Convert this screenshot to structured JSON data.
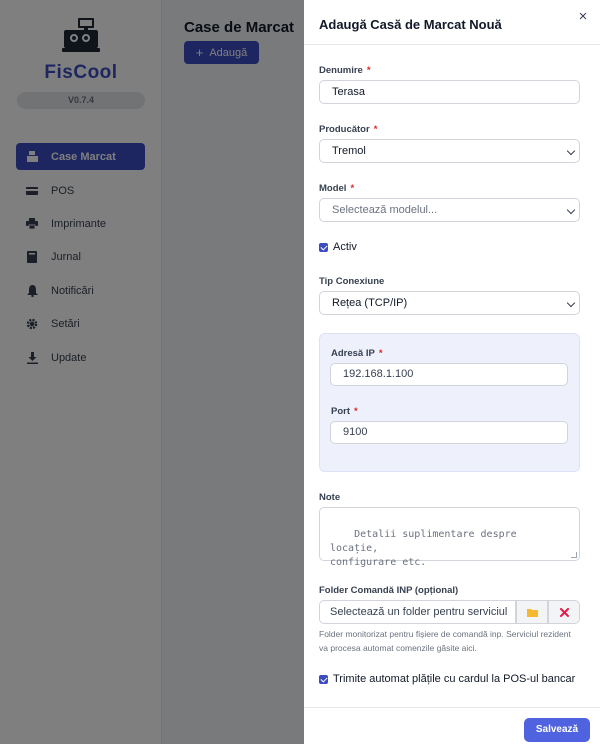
{
  "app": {
    "name": "FisCool",
    "version": "V0.7.4"
  },
  "sidebar": {
    "items": [
      {
        "label": "Case Marcat",
        "icon": "cash-register-icon",
        "active": true
      },
      {
        "label": "POS",
        "icon": "card-terminal-icon"
      },
      {
        "label": "Imprimante",
        "icon": "printer-icon"
      },
      {
        "label": "Jurnal",
        "icon": "book-icon"
      },
      {
        "label": "Notificări",
        "icon": "bell-icon"
      },
      {
        "label": "Setări",
        "icon": "gear-icon"
      },
      {
        "label": "Update",
        "icon": "download-icon"
      }
    ]
  },
  "main": {
    "title": "Case de Marcat",
    "add_label": "Adaugă"
  },
  "drawer": {
    "title": "Adaugă Casă de Marcat Nouă",
    "close_icon": "×",
    "name_label": "Denumire",
    "name_value": "Terasa",
    "producer_label": "Producător",
    "producer_value": "Tremol",
    "model_label": "Model",
    "model_placeholder": "Selectează modelul...",
    "active_label": "Activ",
    "conn_label": "Tip Conexiune",
    "conn_value": "Rețea (TCP/IP)",
    "ip_label": "Adresă IP",
    "ip_value": "192.168.1.100",
    "port_label": "Port",
    "port_value": "9100",
    "notes_label": "Note",
    "notes_placeholder": "Detalii suplimentare despre locație,\nconfigurare etc.",
    "folder_label": "Folder Comandă INP (opțional)",
    "folder_placeholder": "Selectează un folder pentru serviciul",
    "folder_help": "Folder monitorizat pentru fișiere de comandă inp. Serviciul rezident va procesa automat comenzile găsite aici.",
    "auto_pay_label": "Trimite automat plățile cu cardul la POS-ul bancar",
    "save_label": "Salvează",
    "required_mark": "*"
  },
  "colors": {
    "accent": "#3b4cc0",
    "save": "#4f63e0",
    "required": "#dc2626",
    "folder_icon": "#f5b82e",
    "clear_icon": "#e11d48"
  }
}
